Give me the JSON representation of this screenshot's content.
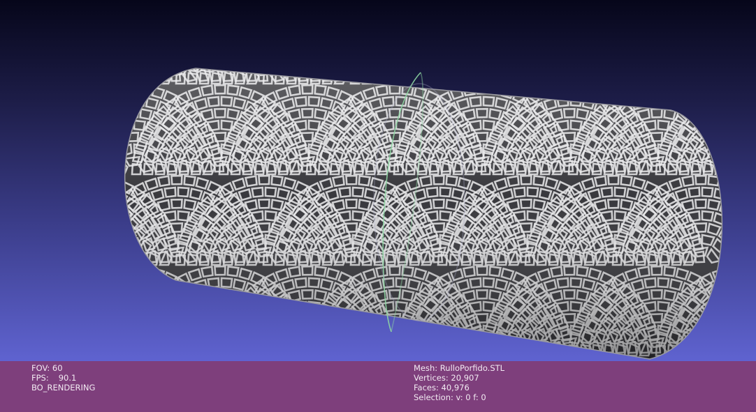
{
  "viewport": {
    "background_top": "#06061a",
    "background_bottom": "#5f63d0",
    "mesh_color_light": "#e8e8ea",
    "mesh_color_dark": "#2a2a2e",
    "trackball_color": "#8fd8a4"
  },
  "status_bar": {
    "background": "#7e3f7c",
    "left": {
      "fov": "FOV: 60",
      "fps_label": "FPS:",
      "fps_value": "90.1",
      "render_mode": "BO_RENDERING"
    },
    "right": {
      "mesh": "Mesh: RulloPorfido.STL",
      "vertices": "Vertices: 20,907",
      "faces": "Faces: 40,976",
      "selection": "Selection: v: 0 f: 0"
    }
  }
}
